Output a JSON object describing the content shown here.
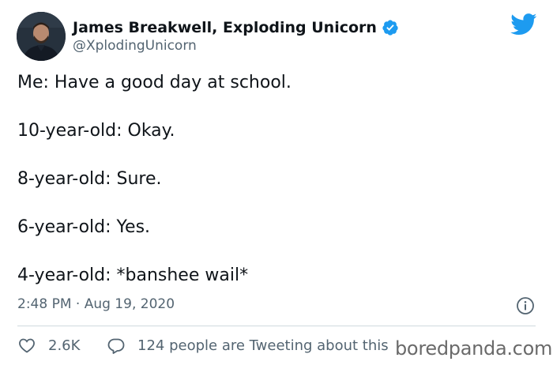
{
  "author": {
    "name": "James Breakwell, Exploding Unicorn",
    "handle": "@XplodingUnicorn",
    "verified": true,
    "avatar_icon": "user-avatar-photo"
  },
  "brand": {
    "logo_icon": "twitter-bird-icon",
    "color": "#1d9bf0"
  },
  "tweet": {
    "lines": [
      "Me: Have a good day at school.",
      "10-year-old: Okay.",
      "8-year-old: Sure.",
      "6-year-old: Yes.",
      "4-year-old: *banshee wail*"
    ],
    "timestamp": "2:48 PM · Aug 19, 2020"
  },
  "actions": {
    "likes": "2.6K",
    "tweeting": "124 people are Tweeting about this"
  },
  "watermark": "boredpanda.com",
  "colors": {
    "text": "#0f1419",
    "secondary": "#536471",
    "divider": "#cfd9de",
    "verified_badge": "#1d9bf0"
  }
}
